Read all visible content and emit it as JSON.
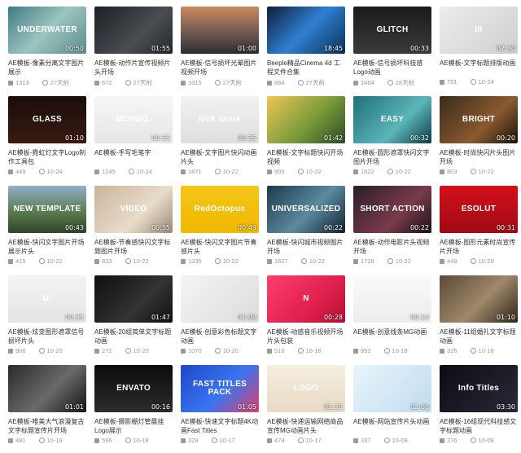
{
  "items": [
    {
      "thumb": "UNDERWATER",
      "duration": "00:50",
      "title": "AE模板-像素分离文字图片展示",
      "views": "1313",
      "date": "27天前",
      "bg": "linear-gradient(135deg,#3f7b86,#9cc4bf 50%,#5c8d8f)"
    },
    {
      "thumb": "",
      "duration": "01:55",
      "title": "AE模板-动作片宣传视频片头开场",
      "views": "672",
      "date": "27天前",
      "bg": "linear-gradient(135deg,#1c1f24,#4a4d52 60%,#24272b)"
    },
    {
      "thumb": "",
      "duration": "01:00",
      "title": "AE模板-信号损坏光晕图片视频开场",
      "views": "3315",
      "date": "27天前",
      "bg": "linear-gradient(180deg,#c98a5c,#6a5550 60%,#2c2b33)"
    },
    {
      "thumb": "",
      "duration": "18:45",
      "title": "Beeple精品Cinema 4d 工程文件合集",
      "views": "884",
      "date": "27天前",
      "bg": "linear-gradient(135deg,#0f1e3a,#2f7fd1 50%,#0a3157)"
    },
    {
      "thumb": "GLITCH",
      "duration": "00:33",
      "title": "AE模板-信号损坏科技感Logo动画",
      "views": "1464",
      "date": "28天前",
      "bg": "linear-gradient(180deg,#1b1b1b,#3a3a3a)"
    },
    {
      "thumb": "III",
      "duration": "02:30",
      "title": "AE模板-文字标题排版动画",
      "views": "791",
      "date": "10-24",
      "bg": "linear-gradient(135deg,#ececec,#cfcfcf)"
    },
    {
      "thumb": "GLASS",
      "duration": "01:10",
      "title": "AE模板-霓虹灯文字Logo制作工具包",
      "views": "449",
      "date": "10-24",
      "bg": "linear-gradient(180deg,#1a0d0a,#3a1a12)"
    },
    {
      "thumb": "MONDO.",
      "duration": "00:55",
      "title": "AE模板-手写毛笔字",
      "views": "1245",
      "date": "10-24",
      "bg": "linear-gradient(180deg,#f6f6f6,#e6e6e6)"
    },
    {
      "thumb": "kick   snare",
      "duration": "00:35",
      "title": "AE模板-文字图片快闪动画片头",
      "views": "1871",
      "date": "10-22",
      "bg": "linear-gradient(180deg,#f2f2f2,#dedede)"
    },
    {
      "thumb": "",
      "duration": "01:42",
      "title": "AE模板-文字标题快闪开场视频",
      "views": "905",
      "date": "10-22",
      "bg": "linear-gradient(135deg,#f0c455,#7a9c3a 55%,#2d4b23)"
    },
    {
      "thumb": "EASY",
      "duration": "00:32",
      "title": "AE模板-圆形遮罩快闪文字图片开场",
      "views": "1622",
      "date": "10-22",
      "bg": "linear-gradient(135deg,#1f6f7c,#5bb5b8 60%,#0d3c47)"
    },
    {
      "thumb": "BRIGHT",
      "duration": "00:20",
      "title": "AE模板-时尚快闪片头图片开场",
      "views": "803",
      "date": "10-22",
      "bg": "linear-gradient(135deg,#3a2a1a,#8a5a30 60%,#1a120a)"
    },
    {
      "thumb": "NEW TEMPLATE",
      "duration": "00:43",
      "title": "AE模板-快闪文字图片开场展示片头",
      "views": "415",
      "date": "10-22",
      "bg": "linear-gradient(180deg,#8fb0c9,#5b7c4d 55%,#2f4428)"
    },
    {
      "thumb": "VIDEO",
      "duration": "00:35",
      "title": "AE模板-节奏感快闪文字标题图片开场",
      "views": "833",
      "date": "10-22",
      "bg": "linear-gradient(135deg,#c8b49b,#e8dccb 60%,#9c8a74)"
    },
    {
      "thumb": "RedOctopus",
      "duration": "00:49",
      "title": "AE模板-快闪文字图片节奏感片头",
      "views": "1335",
      "date": "10-22",
      "bg": "linear-gradient(180deg,#f5c518,#f0b800)"
    },
    {
      "thumb": "UNIVERSALIZED",
      "duration": "00:22",
      "title": "AE模板-快闪城市视频图片开场",
      "views": "1627",
      "date": "10-22",
      "bg": "linear-gradient(135deg,#1e3a4a,#5b8aa0 55%,#12222c)"
    },
    {
      "thumb": "SHORT ACTION",
      "duration": "00:22",
      "title": "AE模板-动作电影片头视频开场",
      "views": "1728",
      "date": "10-22",
      "bg": "linear-gradient(135deg,#2a1f2a,#7a3a4a 60%,#1a1218)"
    },
    {
      "thumb": "ESOLUT",
      "duration": "00:31",
      "title": "AE模板-图形元素时尚宣传片开场",
      "views": "448",
      "date": "10-20",
      "bg": "linear-gradient(180deg,#d2101c,#a00a14)"
    },
    {
      "thumb": "U-",
      "duration": "00:55",
      "title": "AE模板-炫变图形遮罩信号损坏片头",
      "views": "906",
      "date": "10-20",
      "bg": "linear-gradient(180deg,#f4f4f4,#e4e4e4)"
    },
    {
      "thumb": "",
      "duration": "01:47",
      "title": "AE模板-20组简单文字标题动画",
      "views": "272",
      "date": "10-20",
      "bg": "linear-gradient(135deg,#0f0f0f,#333 60%,#111)"
    },
    {
      "thumb": "",
      "duration": "01:08",
      "title": "AE模板-创意彩色标题文字动画",
      "views": "1070",
      "date": "10-20",
      "bg": "linear-gradient(135deg,#f4f4f4,#dcdcdc)"
    },
    {
      "thumb": "N",
      "duration": "00:28",
      "title": "AE模板-动感音乐视频开场片头包装",
      "views": "516",
      "date": "10-18",
      "bg": "linear-gradient(135deg,#ff3d6e,#e0204f 60%,#b4102f)"
    },
    {
      "thumb": "",
      "duration": "00:14",
      "title": "AE模板-创意线条MG动画",
      "views": "952",
      "date": "10-18",
      "bg": "linear-gradient(180deg,#fafafa,#ececec)"
    },
    {
      "thumb": "",
      "duration": "01:10",
      "title": "AE模板-11组婚礼文字标题动画",
      "views": "326",
      "date": "10-18",
      "bg": "linear-gradient(135deg,#5a4a3a,#a0886a 55%,#2e241a)"
    },
    {
      "thumb": "",
      "duration": "01:01",
      "title": "AE模板-唯美大气浪漫复古文字标题宣传片开场",
      "views": "481",
      "date": "10-18",
      "bg": "linear-gradient(135deg,#2a2a2a,#6a6a6a 55%,#151515)"
    },
    {
      "thumb": "ENVATO",
      "duration": "00:16",
      "title": "AE模板-摄影棚灯管晨挂Logo展示",
      "views": "596",
      "date": "10-18",
      "bg": "linear-gradient(180deg,#0c0c0c,#2c2c2c)"
    },
    {
      "thumb": "FAST TITLES PACK",
      "duration": "01:05",
      "title": "AE模板-快速文字标题4K动画Fast Titles",
      "views": "329",
      "date": "10-17",
      "bg": "linear-gradient(135deg,#1e48c8,#3a74f0 55%,#e0406a)"
    },
    {
      "thumb": "LOGO",
      "duration": "01:25",
      "title": "AE模板-快递运输网络商品宣传MG动画片头",
      "views": "474",
      "date": "10-17",
      "bg": "linear-gradient(180deg,#f6eee2,#e9dac3)"
    },
    {
      "thumb": "",
      "duration": "02:06",
      "title": "AE模板-网站宣传片头动画",
      "views": "337",
      "date": "10-09",
      "bg": "linear-gradient(135deg,#e9f4fb,#bfdcef)"
    },
    {
      "thumb": "Info Titles",
      "duration": "03:30",
      "title": "AE模板-16组现代科技感文字标题动画",
      "views": "276",
      "date": "10-09",
      "bg": "linear-gradient(135deg,#0c0c14,#2a2a38)"
    }
  ]
}
